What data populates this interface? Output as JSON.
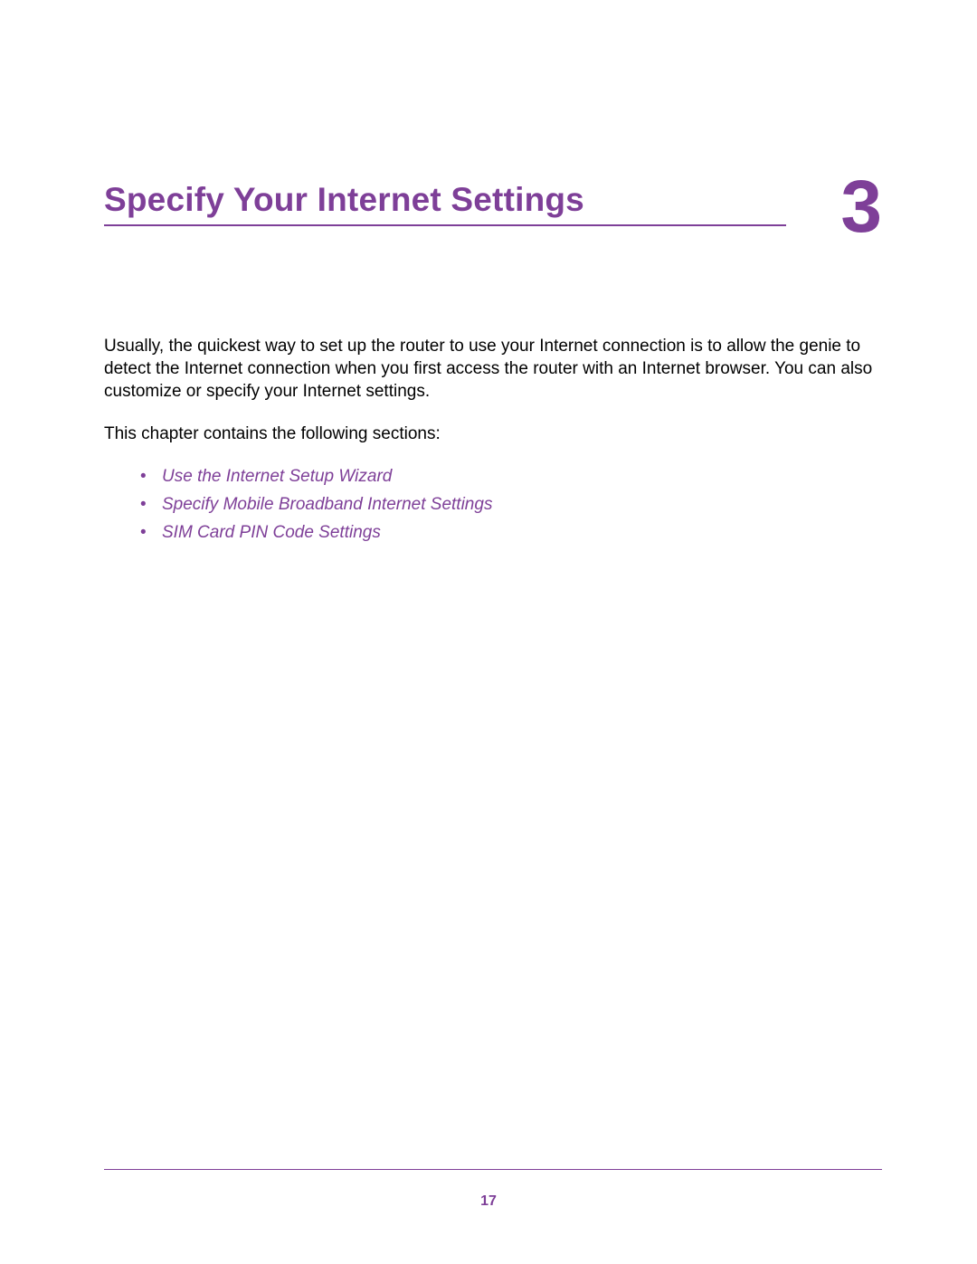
{
  "chapter": {
    "title": "Specify Your Internet Settings",
    "number": "3"
  },
  "intro_paragraph": "Usually, the quickest way to set up the router to use your Internet connection is to allow the genie to detect the Internet connection when you first access the router with an Internet browser. You can also customize or specify your Internet settings.",
  "sections_lead": "This chapter contains the following sections:",
  "section_links": [
    "Use the Internet Setup Wizard",
    "Specify Mobile Broadband Internet Settings",
    "SIM Card PIN Code Settings"
  ],
  "page_number": "17"
}
